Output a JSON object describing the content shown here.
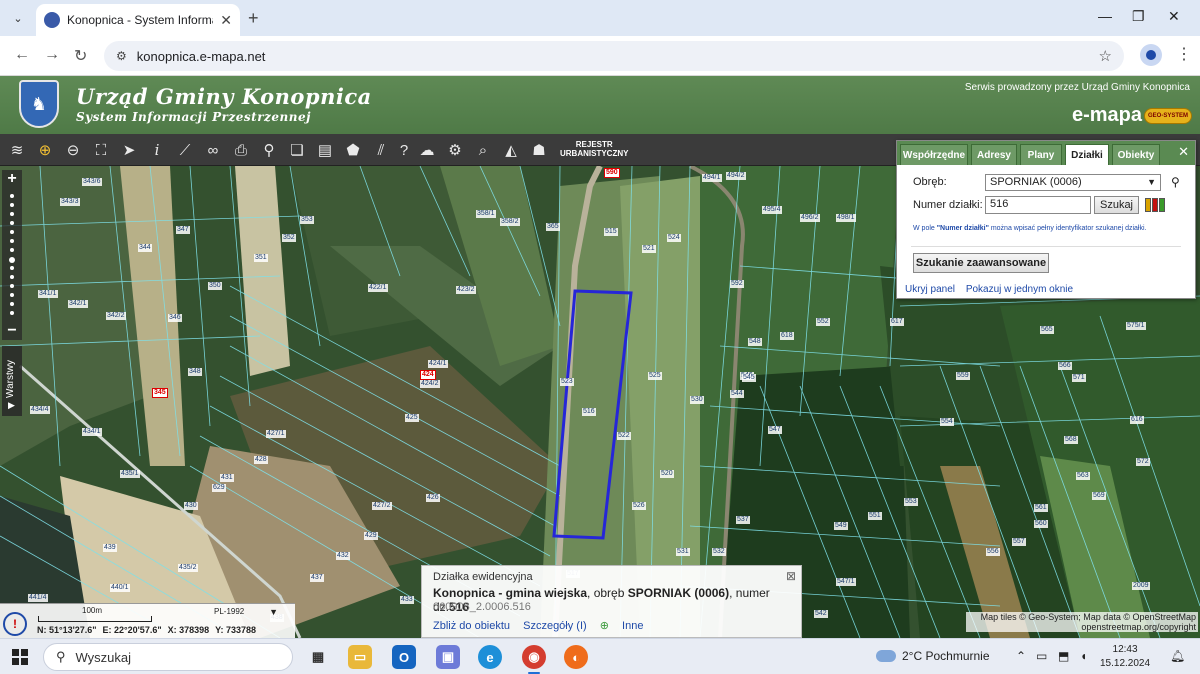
{
  "browser": {
    "tab_title": "Konopnica - System Informacji",
    "url": "konopnica.e-mapa.net",
    "new_tab": "+",
    "tab_close": "✕"
  },
  "header": {
    "title": "Urząd Gminy Konopnica",
    "subtitle": "System Informacji Przestrzennej",
    "service_note": "Serwis prowadzony przez Urząd Gminy Konopnica",
    "brand": "e-mapa",
    "brand_badge": "GEO-SYSTEM"
  },
  "toolbar": {
    "rejestr_line1": "REJESTR",
    "rejestr_line2": "URBANISTYCZNY",
    "tools": [
      "layers-icon",
      "zoom-in-icon",
      "zoom-out-icon",
      "zoom-extent-icon",
      "pointer-icon",
      "info-icon",
      "measure-icon",
      "link-icon",
      "print-icon",
      "location-icon",
      "copy-icon",
      "layout-icon",
      "shape-icon",
      "hatch-icon",
      "help-icon",
      "download-icon",
      "settings-icon",
      "search-icon",
      "compass-icon",
      "street-icon"
    ]
  },
  "map_controls": {
    "zoom_in": "+",
    "zoom_out": "−",
    "layers_label": "Warstwy"
  },
  "search_panel": {
    "tabs": [
      "Współrzędne",
      "Adresy",
      "Plany",
      "Działki",
      "Obiekty"
    ],
    "selected_tab": "Działki",
    "obreb_label": "Obręb:",
    "obreb_value": "SPORNIAK (0006)",
    "numer_label": "Numer działki:",
    "numer_value": "516",
    "search_button": "Szukaj",
    "hint_prefix": "W pole ",
    "hint_field": "\"Numer działki\"",
    "hint_suffix": " można wpisać pełny identyfikator szukanej działki.",
    "advanced_button": "Szukanie zaawansowane",
    "link_hide": "Ukryj panel",
    "link_window": "Pokazuj w jednym oknie",
    "color_swatches": [
      "#d9a300",
      "#c41010",
      "#3a9a2a"
    ]
  },
  "parcel_info": {
    "heading": "Działka ewidencyjna",
    "place": "Konopnica - gmina wiejska",
    "obreb_text": ", obręb ",
    "obreb": "SPORNIAK (0006)",
    "numer_text": ", numer dz.",
    "numer": "516",
    "identifier": "060908_2.0006.516",
    "link_zoom": "Zbliż do obiektu",
    "link_details": "Szczegóły (I)",
    "link_other": "Inne"
  },
  "scale": {
    "scale_label": "100m",
    "crs": "PL-1992",
    "lat": "N: 51°13'27.6\"",
    "lon": "E: 22°20'57.6\"",
    "x": "X: 378398",
    "y": "Y: 733788"
  },
  "attribution": {
    "line1": "Map tiles © Geo-System; Map data © OpenStreetMap",
    "line2": "openstreetmap.org/copyright"
  },
  "parcel_labels": [
    {
      "t": "343/6"
    },
    {
      "t": "343/3"
    },
    {
      "t": "344"
    },
    {
      "t": "347"
    },
    {
      "t": "353"
    },
    {
      "t": "358/1"
    },
    {
      "t": "358/2"
    },
    {
      "t": "365"
    },
    {
      "t": "351"
    },
    {
      "t": "352"
    },
    {
      "t": "350"
    },
    {
      "t": "341/1"
    },
    {
      "t": "342/1"
    },
    {
      "t": "342/2"
    },
    {
      "t": "346"
    },
    {
      "t": "348"
    },
    {
      "t": "345"
    },
    {
      "t": "422/1"
    },
    {
      "t": "423/2"
    },
    {
      "t": "424/1"
    },
    {
      "t": "424"
    },
    {
      "t": "424/2"
    },
    {
      "t": "425"
    },
    {
      "t": "427/1"
    },
    {
      "t": "428"
    },
    {
      "t": "426"
    },
    {
      "t": "427/2"
    },
    {
      "t": "429"
    },
    {
      "t": "431"
    },
    {
      "t": "629"
    },
    {
      "t": "430"
    },
    {
      "t": "432"
    },
    {
      "t": "435/1"
    },
    {
      "t": "434/4"
    },
    {
      "t": "434/1"
    },
    {
      "t": "439"
    },
    {
      "t": "440/1"
    },
    {
      "t": "441/4"
    },
    {
      "t": "435/2"
    },
    {
      "t": "437"
    },
    {
      "t": "438"
    },
    {
      "t": "433"
    },
    {
      "t": "515"
    },
    {
      "t": "521"
    },
    {
      "t": "524"
    },
    {
      "t": "523"
    },
    {
      "t": "516"
    },
    {
      "t": "525"
    },
    {
      "t": "522"
    },
    {
      "t": "530"
    },
    {
      "t": "520"
    },
    {
      "t": "526"
    },
    {
      "t": "531"
    },
    {
      "t": "532"
    },
    {
      "t": "517"
    },
    {
      "t": "494/1"
    },
    {
      "t": "494/2"
    },
    {
      "t": "495/4"
    },
    {
      "t": "496/2"
    },
    {
      "t": "498/1"
    },
    {
      "t": "592"
    },
    {
      "t": "548"
    },
    {
      "t": "618"
    },
    {
      "t": "552"
    },
    {
      "t": "617"
    },
    {
      "t": "546"
    },
    {
      "t": "544"
    },
    {
      "t": "545"
    },
    {
      "t": "547"
    },
    {
      "t": "537"
    },
    {
      "t": "549"
    },
    {
      "t": "551"
    },
    {
      "t": "553"
    },
    {
      "t": "554"
    },
    {
      "t": "556"
    },
    {
      "t": "557"
    },
    {
      "t": "559"
    },
    {
      "t": "561"
    },
    {
      "t": "560"
    },
    {
      "t": "563"
    },
    {
      "t": "569"
    },
    {
      "t": "572"
    },
    {
      "t": "568"
    },
    {
      "t": "566"
    },
    {
      "t": "565"
    },
    {
      "t": "571"
    },
    {
      "t": "575/1"
    },
    {
      "t": "616"
    },
    {
      "t": "547/1"
    },
    {
      "t": "542"
    },
    {
      "t": "2009"
    },
    {
      "t": "590"
    }
  ],
  "taskbar": {
    "search_label": "Wyszukaj",
    "weather": "2°C  Pochmurnie",
    "time": "12:43",
    "date": "15.12.2024"
  }
}
